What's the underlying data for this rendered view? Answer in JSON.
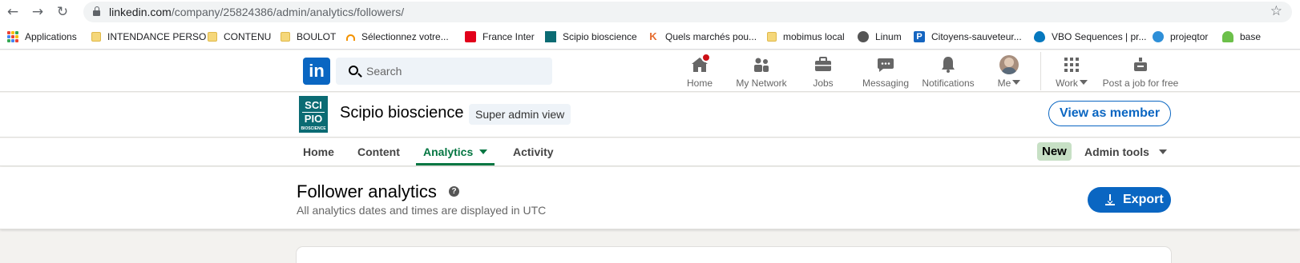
{
  "browser": {
    "url_host": "linkedin.com",
    "url_path": "/company/25824386/admin/analytics/followers/",
    "bookmarks": [
      {
        "label": "Applications",
        "icon": "apps-grid-icon"
      },
      {
        "label": "INTENDANCE PERSO",
        "icon": "folder-icon"
      },
      {
        "label": "CONTENU",
        "icon": "folder-icon"
      },
      {
        "label": "BOULOT",
        "icon": "folder-icon"
      },
      {
        "label": "Sélectionnez votre...",
        "icon": "headphones-icon"
      },
      {
        "label": "France Inter",
        "icon": "france-inter-icon"
      },
      {
        "label": "Scipio bioscience",
        "icon": "scipio-icon"
      },
      {
        "label": "Quels marchés pou...",
        "icon": "k-icon"
      },
      {
        "label": "mobimus local",
        "icon": "folder-icon"
      },
      {
        "label": "Linum",
        "icon": "globe-icon"
      },
      {
        "label": "Citoyens-sauveteur...",
        "icon": "p-icon"
      },
      {
        "label": "VBO Sequences | pr...",
        "icon": "drupal-icon"
      },
      {
        "label": "projeqtor",
        "icon": "projeqtor-icon"
      },
      {
        "label": "base",
        "icon": "base-icon"
      }
    ]
  },
  "linkedin_nav": {
    "search_placeholder": "Search",
    "items": [
      {
        "label": "Home",
        "icon": "home-icon"
      },
      {
        "label": "My Network",
        "icon": "network-icon"
      },
      {
        "label": "Jobs",
        "icon": "briefcase-icon"
      },
      {
        "label": "Messaging",
        "icon": "messaging-icon"
      },
      {
        "label": "Notifications",
        "icon": "bell-icon"
      },
      {
        "label": "Me",
        "icon": "avatar"
      },
      {
        "label": "Work",
        "icon": "grid-icon"
      },
      {
        "label": "Post a job for free",
        "icon": "post-job-icon"
      }
    ],
    "brand_color": "#0a66c2",
    "notification_color": "#cc1016"
  },
  "company": {
    "name": "Scipio bioscience",
    "admin_view": "Super admin view",
    "view_as_member": "View as member",
    "logo_top": "SCI",
    "logo_bottom": "PIO",
    "logo_small": "BIOSCIENCE"
  },
  "sub_nav": {
    "tabs": [
      {
        "label": "Home"
      },
      {
        "label": "Content"
      },
      {
        "label": "Analytics"
      },
      {
        "label": "Activity"
      }
    ],
    "active_tab": "Analytics",
    "new_badge": "New",
    "admin_tools": "Admin tools",
    "active_color": "#057642"
  },
  "follower_analytics": {
    "title": "Follower analytics",
    "subtitle": "All analytics dates and times are displayed in UTC",
    "export_label": "Export"
  }
}
